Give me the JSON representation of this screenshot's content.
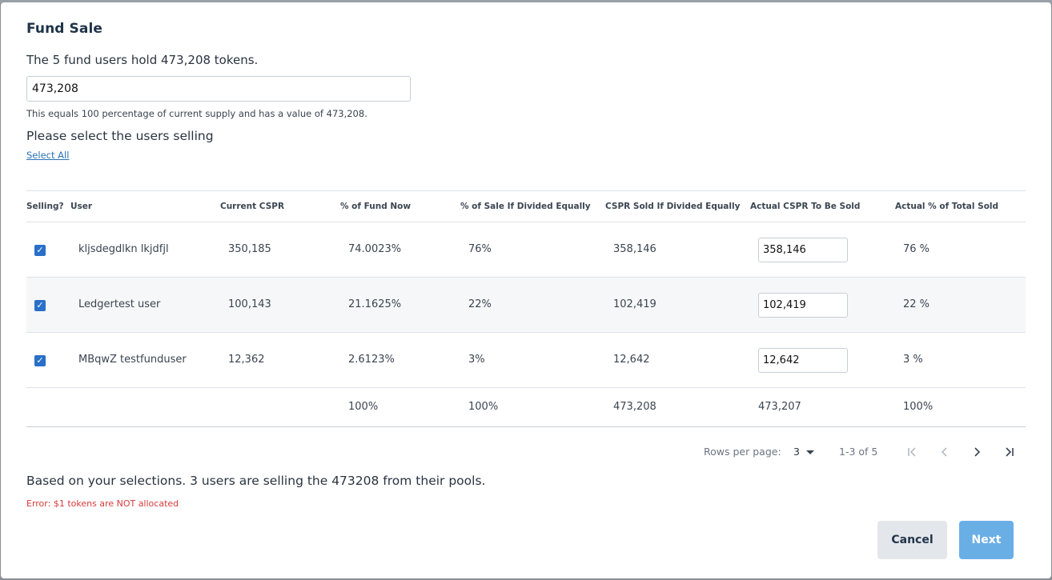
{
  "dialog": {
    "title": "Fund Sale",
    "summary": "The 5 fund users hold 473,208 tokens.",
    "tokens_input_value": "473,208",
    "equals_text": "This equals 100 percentage of current supply and has a value of 473,208.",
    "select_heading": "Please select the users selling",
    "select_all_label": "Select All"
  },
  "table": {
    "headers": {
      "selling": "Selling?",
      "user": "User",
      "current": "Current CSPR",
      "fund_now": "% of Fund Now",
      "sale_equal": "% of Sale If Divided Equally",
      "sold_equal": "CSPR Sold If Divided Equally",
      "actual_sold": "Actual CSPR To Be Sold",
      "actual_pct": "Actual % of Total Sold"
    },
    "rows": [
      {
        "checked": true,
        "user": "kljsdegdlkn lkjdfjl",
        "current": "350,185",
        "fund_now": "74.0023%",
        "sale_equal": "76%",
        "sold_equal": "358,146",
        "actual_sold": "358,146",
        "actual_pct": "76 %"
      },
      {
        "checked": true,
        "user": "Ledgertest user",
        "current": "100,143",
        "fund_now": "21.1625%",
        "sale_equal": "22%",
        "sold_equal": "102,419",
        "actual_sold": "102,419",
        "actual_pct": "22 %"
      },
      {
        "checked": true,
        "user": "MBqwZ testfunduser",
        "current": "12,362",
        "fund_now": "2.6123%",
        "sale_equal": "3%",
        "sold_equal": "12,642",
        "actual_sold": "12,642",
        "actual_pct": "3 %"
      }
    ],
    "totals": {
      "fund_now": "100%",
      "sale_equal": "100%",
      "sold_equal": "473,208",
      "actual_sold": "473,207",
      "actual_pct": "100%"
    }
  },
  "pagination": {
    "rows_per_page_label": "Rows per page:",
    "rows_per_page_value": "3",
    "range": "1-3 of 5"
  },
  "footer": {
    "based_text": "Based on your selections. 3 users are selling the 473208 from their pools.",
    "error_text": "Error: $1 tokens are NOT allocated",
    "cancel_label": "Cancel",
    "next_label": "Next"
  },
  "colors": {
    "checkbox": "#2a6fc9",
    "error": "#d63a3a",
    "next_button": "#6aaee6",
    "cancel_button": "#e3e6ea"
  }
}
